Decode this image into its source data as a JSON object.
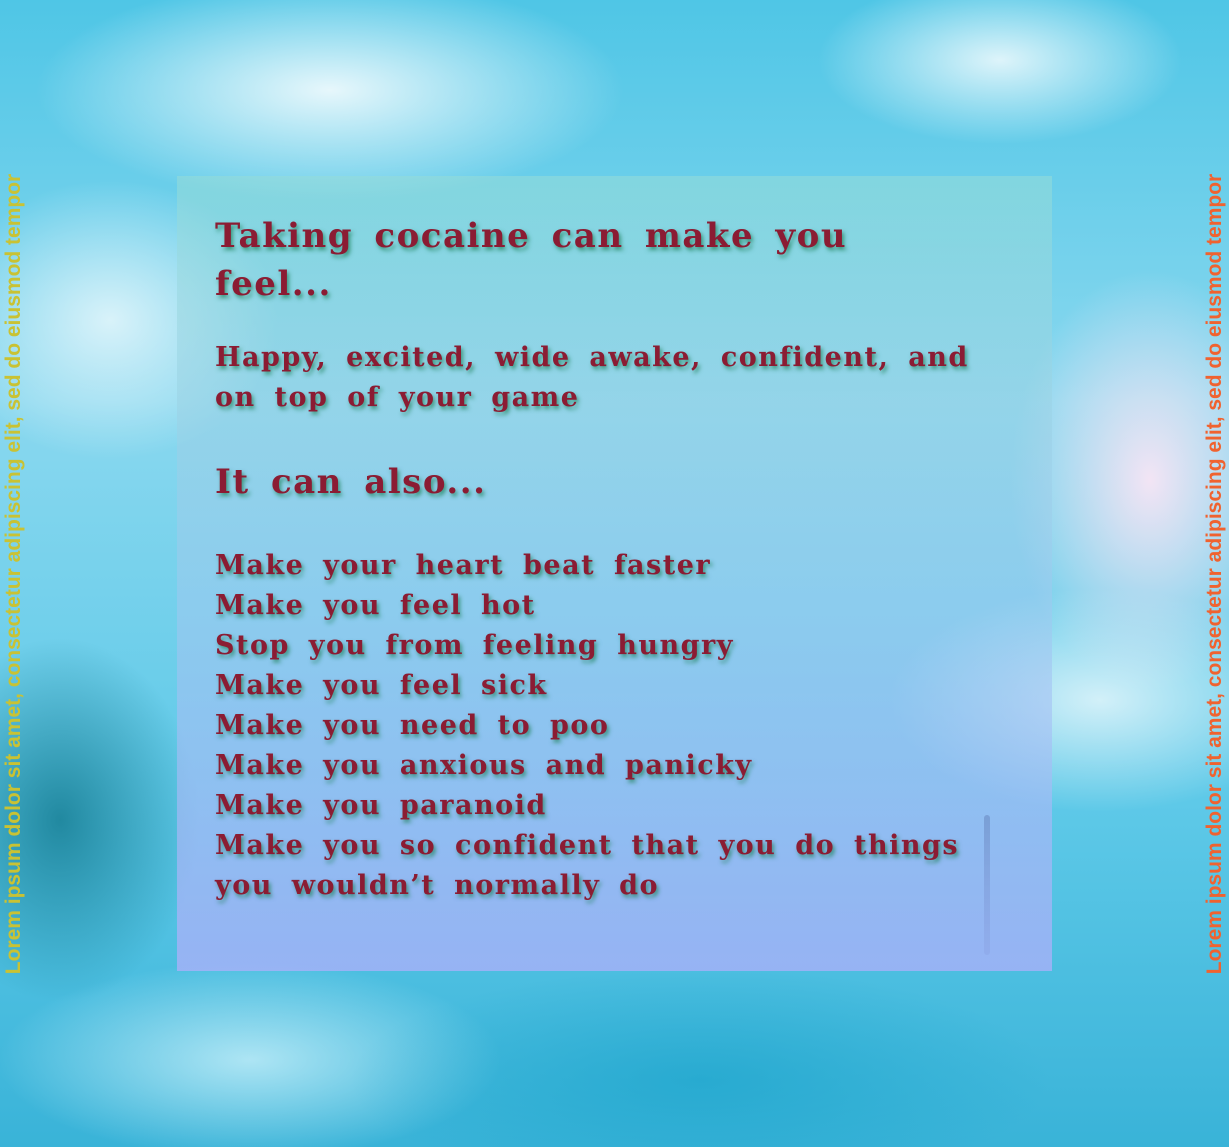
{
  "panel": {
    "heading": "Taking cocaine can make you feel...",
    "intro": "Happy, excited, wide awake, confident, and on top of your game",
    "also_heading": "It can also...",
    "effects": [
      "Make your heart beat faster",
      "Make you feel hot",
      "Stop you from feeling hungry",
      "Make you feel sick",
      "Make you need to poo",
      "Make you anxious and panicky",
      "Make you paranoid",
      "Make you so confident that you do things",
      "you wouldn’t normally do"
    ]
  },
  "side_text": {
    "left": "Lorem ipsum dolor sit amet, consectetur adipiscing elit, sed do eiusmod tempor",
    "right": "Lorem ipsum dolor sit amet, consectetur adipiscing elit, sed do eiusmod tempor"
  },
  "colors": {
    "text": "#8b1c33",
    "left_side_text": "#c9c233",
    "right_side_text": "#f0622f"
  }
}
